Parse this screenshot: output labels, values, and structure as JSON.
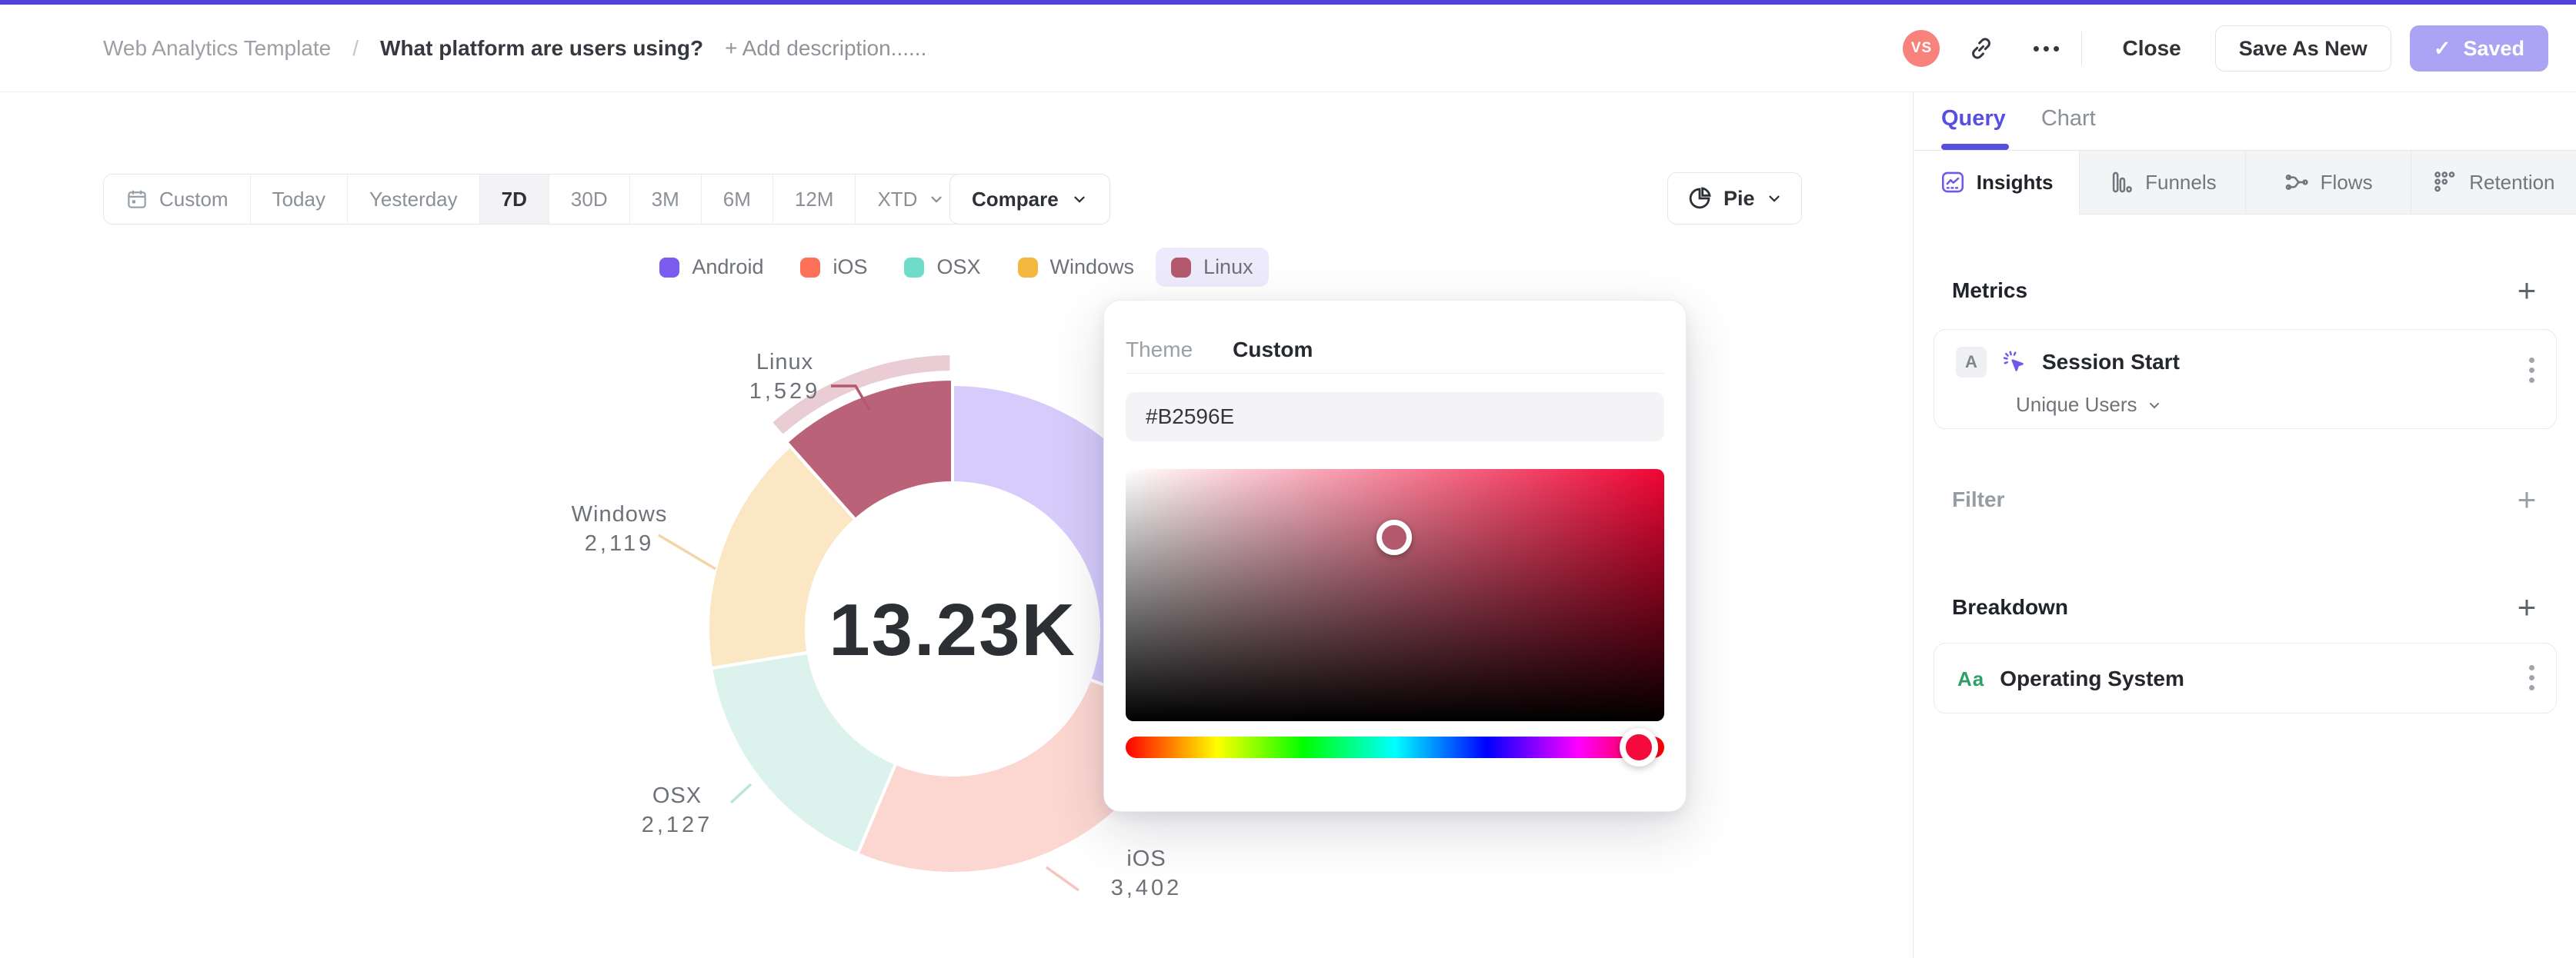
{
  "colors": {
    "top_border": "#4e42d8",
    "accent": "#574fe0",
    "avatar": "#f8837d",
    "saved_bg": "#aba4f4",
    "green": "#2e9e6b",
    "linux": "#b2596e"
  },
  "header": {
    "breadcrumb": "Web Analytics Template",
    "separator": "/",
    "title": "What platform are users using?",
    "add_description": "+ Add description......",
    "avatar_initials": "VS",
    "ellipsis": "•••",
    "close_label": "Close",
    "save_as_new_label": "Save As New",
    "saved_check": "✓",
    "saved_label": "Saved"
  },
  "toolbar": {
    "ranges": [
      {
        "label": "Custom",
        "selected": false,
        "icon": "calendar"
      },
      {
        "label": "Today",
        "selected": false
      },
      {
        "label": "Yesterday",
        "selected": false
      },
      {
        "label": "7D",
        "selected": true
      },
      {
        "label": "30D",
        "selected": false
      },
      {
        "label": "3M",
        "selected": false
      },
      {
        "label": "6M",
        "selected": false
      },
      {
        "label": "12M",
        "selected": false
      },
      {
        "label": "XTD",
        "selected": false,
        "has_dropdown": true
      }
    ],
    "compare_label": "Compare",
    "chart_type_label": "Pie"
  },
  "legend": {
    "items": [
      {
        "label": "Android",
        "color": "#7c5cf0",
        "highlighted": false
      },
      {
        "label": "iOS",
        "color": "#fc7158",
        "highlighted": false
      },
      {
        "label": "OSX",
        "color": "#6edcc8",
        "highlighted": false
      },
      {
        "label": "Windows",
        "color": "#f4b73f",
        "highlighted": false
      },
      {
        "label": "Linux",
        "color": "#b2596e",
        "highlighted": true
      }
    ]
  },
  "chart_data": {
    "type": "pie",
    "donut": true,
    "center_total": "13.23K",
    "total_value": 13230,
    "metric": "Session Start · Unique Users",
    "categories": [
      "Android",
      "iOS",
      "OSX",
      "Windows",
      "Linux"
    ],
    "values": [
      4053,
      3402,
      2127,
      2119,
      1529
    ],
    "start_angle_deg": 0,
    "clockwise": true,
    "legend_position": "top-center",
    "slices": [
      {
        "name": "Android",
        "value": 4053,
        "display": "",
        "fill": "#d6cbfa",
        "legend_color": "#7c5cf0",
        "leader": "#d6cbfa",
        "highlighted": false
      },
      {
        "name": "iOS",
        "value": 3402,
        "display": "3,402",
        "fill": "#fcd6d1",
        "legend_color": "#fc7158",
        "leader": "#f6c5bf",
        "highlighted": false
      },
      {
        "name": "OSX",
        "value": 2127,
        "display": "2,127",
        "fill": "#dbf3ec",
        "legend_color": "#6edcc8",
        "leader": "#b9e6d9",
        "highlighted": false
      },
      {
        "name": "Windows",
        "value": 2119,
        "display": "2,119",
        "fill": "#fbe7c3",
        "legend_color": "#f4b73f",
        "leader": "#f2d6a7",
        "highlighted": false
      },
      {
        "name": "Linux",
        "value": 1529,
        "display": "1,529",
        "fill": "#ba6277",
        "legend_color": "#b2596e",
        "leader": "#b2596e",
        "ring": "#e9ccd4",
        "highlighted": true
      }
    ]
  },
  "color_picker": {
    "tabs": [
      {
        "label": "Theme",
        "active": false
      },
      {
        "label": "Custom",
        "active": true
      }
    ],
    "hex_value": "#B2596E",
    "hue_thumb_color": "#f50a3d"
  },
  "sidebar": {
    "tabs": [
      {
        "label": "Query",
        "active": true
      },
      {
        "label": "Chart",
        "active": false
      }
    ],
    "view_tabs": [
      {
        "label": "Insights",
        "active": true
      },
      {
        "label": "Funnels",
        "active": false
      },
      {
        "label": "Flows",
        "active": false
      },
      {
        "label": "Retention",
        "active": false
      }
    ],
    "metrics": {
      "heading": "Metrics",
      "add": "+",
      "card": {
        "badge": "A",
        "label": "Session Start",
        "sub": "Unique Users"
      }
    },
    "filter": {
      "heading": "Filter",
      "add": "+"
    },
    "breakdown": {
      "heading": "Breakdown",
      "add": "+",
      "card": {
        "badge": "Aa",
        "label": "Operating System"
      }
    }
  }
}
